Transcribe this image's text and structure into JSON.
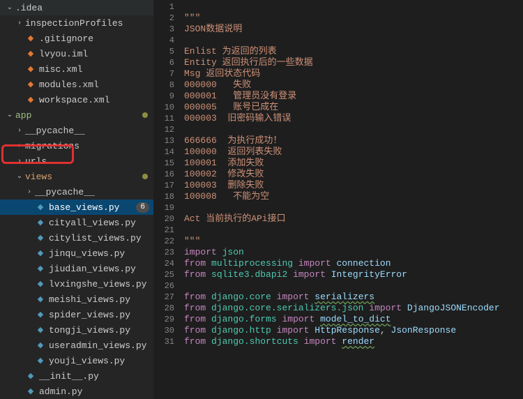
{
  "tree": [
    {
      "indent": 0,
      "chevron": "down",
      "icon": "",
      "iconClass": "",
      "label": ".idea",
      "cls": "",
      "dot": false,
      "badge": ""
    },
    {
      "indent": 1,
      "chevron": "right",
      "icon": "",
      "iconClass": "",
      "label": "inspectionProfiles",
      "cls": "",
      "dot": false,
      "badge": ""
    },
    {
      "indent": 1,
      "chevron": "",
      "icon": "◆",
      "iconClass": "xml",
      "label": ".gitignore",
      "cls": "",
      "dot": false,
      "badge": ""
    },
    {
      "indent": 1,
      "chevron": "",
      "icon": "◆",
      "iconClass": "xml",
      "label": "lvyou.iml",
      "cls": "",
      "dot": false,
      "badge": ""
    },
    {
      "indent": 1,
      "chevron": "",
      "icon": "◆",
      "iconClass": "xml",
      "label": "misc.xml",
      "cls": "",
      "dot": false,
      "badge": ""
    },
    {
      "indent": 1,
      "chevron": "",
      "icon": "◆",
      "iconClass": "xml",
      "label": "modules.xml",
      "cls": "",
      "dot": false,
      "badge": ""
    },
    {
      "indent": 1,
      "chevron": "",
      "icon": "◆",
      "iconClass": "xml",
      "label": "workspace.xml",
      "cls": "",
      "dot": false,
      "badge": ""
    },
    {
      "indent": 0,
      "chevron": "down",
      "icon": "",
      "iconClass": "",
      "label": "app",
      "cls": "appcolor",
      "dot": true,
      "badge": ""
    },
    {
      "indent": 1,
      "chevron": "right",
      "icon": "",
      "iconClass": "",
      "label": "__pycache__",
      "cls": "",
      "dot": false,
      "badge": ""
    },
    {
      "indent": 1,
      "chevron": "right",
      "icon": "",
      "iconClass": "",
      "label": "migrations",
      "cls": "",
      "dot": false,
      "badge": ""
    },
    {
      "indent": 1,
      "chevron": "right",
      "icon": "",
      "iconClass": "",
      "label": "urls",
      "cls": "",
      "dot": false,
      "badge": ""
    },
    {
      "indent": 1,
      "chevron": "down",
      "icon": "",
      "iconClass": "",
      "label": "views",
      "cls": "viewscolor",
      "dot": true,
      "badge": ""
    },
    {
      "indent": 2,
      "chevron": "right",
      "icon": "",
      "iconClass": "",
      "label": "__pycache__",
      "cls": "",
      "dot": false,
      "badge": ""
    },
    {
      "indent": 2,
      "chevron": "",
      "icon": "◆",
      "iconClass": "py",
      "label": "base_views.py",
      "cls": "selected",
      "dot": false,
      "badge": "6"
    },
    {
      "indent": 2,
      "chevron": "",
      "icon": "◆",
      "iconClass": "py",
      "label": "cityall_views.py",
      "cls": "",
      "dot": false,
      "badge": ""
    },
    {
      "indent": 2,
      "chevron": "",
      "icon": "◆",
      "iconClass": "py",
      "label": "citylist_views.py",
      "cls": "",
      "dot": false,
      "badge": ""
    },
    {
      "indent": 2,
      "chevron": "",
      "icon": "◆",
      "iconClass": "py",
      "label": "jinqu_views.py",
      "cls": "",
      "dot": false,
      "badge": ""
    },
    {
      "indent": 2,
      "chevron": "",
      "icon": "◆",
      "iconClass": "py",
      "label": "jiudian_views.py",
      "cls": "",
      "dot": false,
      "badge": ""
    },
    {
      "indent": 2,
      "chevron": "",
      "icon": "◆",
      "iconClass": "py",
      "label": "lvxingshe_views.py",
      "cls": "",
      "dot": false,
      "badge": ""
    },
    {
      "indent": 2,
      "chevron": "",
      "icon": "◆",
      "iconClass": "py",
      "label": "meishi_views.py",
      "cls": "",
      "dot": false,
      "badge": ""
    },
    {
      "indent": 2,
      "chevron": "",
      "icon": "◆",
      "iconClass": "py",
      "label": "spider_views.py",
      "cls": "",
      "dot": false,
      "badge": ""
    },
    {
      "indent": 2,
      "chevron": "",
      "icon": "◆",
      "iconClass": "py",
      "label": "tongji_views.py",
      "cls": "",
      "dot": false,
      "badge": ""
    },
    {
      "indent": 2,
      "chevron": "",
      "icon": "◆",
      "iconClass": "py",
      "label": "useradmin_views.py",
      "cls": "",
      "dot": false,
      "badge": ""
    },
    {
      "indent": 2,
      "chevron": "",
      "icon": "◆",
      "iconClass": "py",
      "label": "youji_views.py",
      "cls": "",
      "dot": false,
      "badge": ""
    },
    {
      "indent": 1,
      "chevron": "",
      "icon": "◆",
      "iconClass": "py",
      "label": "__init__.py",
      "cls": "",
      "dot": false,
      "badge": ""
    },
    {
      "indent": 1,
      "chevron": "",
      "icon": "◆",
      "iconClass": "py",
      "label": "admin.py",
      "cls": "",
      "dot": false,
      "badge": ""
    }
  ],
  "code": {
    "start": 1,
    "lines": [
      [],
      [
        [
          "str",
          "\"\"\""
        ]
      ],
      [
        [
          "str",
          "JSON数据说明"
        ]
      ],
      [],
      [
        [
          "str",
          "Enlist 为返回的列表"
        ]
      ],
      [
        [
          "str",
          "Entity 返回执行后的一些数据"
        ]
      ],
      [
        [
          "str",
          "Msg 返回状态代码"
        ]
      ],
      [
        [
          "str",
          "000000   失败"
        ]
      ],
      [
        [
          "str",
          "000001   管理员没有登录"
        ]
      ],
      [
        [
          "str",
          "000005   账号已成在"
        ]
      ],
      [
        [
          "str",
          "000003  旧密码输入错误"
        ]
      ],
      [],
      [
        [
          "str",
          "666666  为执行成功！"
        ]
      ],
      [
        [
          "str",
          "100000  返回列表失败"
        ]
      ],
      [
        [
          "str",
          "100001  添加失败"
        ]
      ],
      [
        [
          "str",
          "100002  修改失败"
        ]
      ],
      [
        [
          "str",
          "100003  删除失败"
        ]
      ],
      [
        [
          "str",
          "100008   不能为空"
        ]
      ],
      [],
      [
        [
          "str",
          "Act 当前执行的APi接口"
        ]
      ],
      [],
      [
        [
          "str",
          "\"\"\""
        ]
      ],
      [
        [
          "key",
          "import"
        ],
        [
          "plain",
          " "
        ],
        [
          "mod",
          "json"
        ]
      ],
      [
        [
          "key",
          "from"
        ],
        [
          "plain",
          " "
        ],
        [
          "mod",
          "multiprocessing"
        ],
        [
          "plain",
          " "
        ],
        [
          "key",
          "import"
        ],
        [
          "plain",
          " "
        ],
        [
          "id",
          "connection"
        ]
      ],
      [
        [
          "key",
          "from"
        ],
        [
          "plain",
          " "
        ],
        [
          "mod",
          "sqlite3.dbapi2"
        ],
        [
          "plain",
          " "
        ],
        [
          "key",
          "import"
        ],
        [
          "plain",
          " "
        ],
        [
          "id",
          "IntegrityError"
        ]
      ],
      [],
      [
        [
          "key",
          "from"
        ],
        [
          "plain",
          " "
        ],
        [
          "mod",
          "django.core"
        ],
        [
          "plain",
          " "
        ],
        [
          "key",
          "import"
        ],
        [
          "plain",
          " "
        ],
        [
          "sq",
          "serializers"
        ]
      ],
      [
        [
          "key",
          "from"
        ],
        [
          "plain",
          " "
        ],
        [
          "mod",
          "django.core.serializers.json"
        ],
        [
          "plain",
          " "
        ],
        [
          "key",
          "import"
        ],
        [
          "plain",
          " "
        ],
        [
          "id",
          "DjangoJSONEncoder"
        ]
      ],
      [
        [
          "key",
          "from"
        ],
        [
          "plain",
          " "
        ],
        [
          "mod",
          "django.forms"
        ],
        [
          "plain",
          " "
        ],
        [
          "key",
          "import"
        ],
        [
          "plain",
          " "
        ],
        [
          "sq",
          "model_to_dict"
        ]
      ],
      [
        [
          "key",
          "from"
        ],
        [
          "plain",
          " "
        ],
        [
          "mod",
          "django.http"
        ],
        [
          "plain",
          " "
        ],
        [
          "key",
          "import"
        ],
        [
          "plain",
          " "
        ],
        [
          "id",
          "HttpResponse"
        ],
        [
          "plain",
          ", "
        ],
        [
          "id",
          "JsonResponse"
        ]
      ],
      [
        [
          "key",
          "from"
        ],
        [
          "plain",
          " "
        ],
        [
          "mod",
          "django.shortcuts"
        ],
        [
          "plain",
          " "
        ],
        [
          "key",
          "import"
        ],
        [
          "plain",
          " "
        ],
        [
          "sq",
          "render"
        ]
      ]
    ]
  }
}
